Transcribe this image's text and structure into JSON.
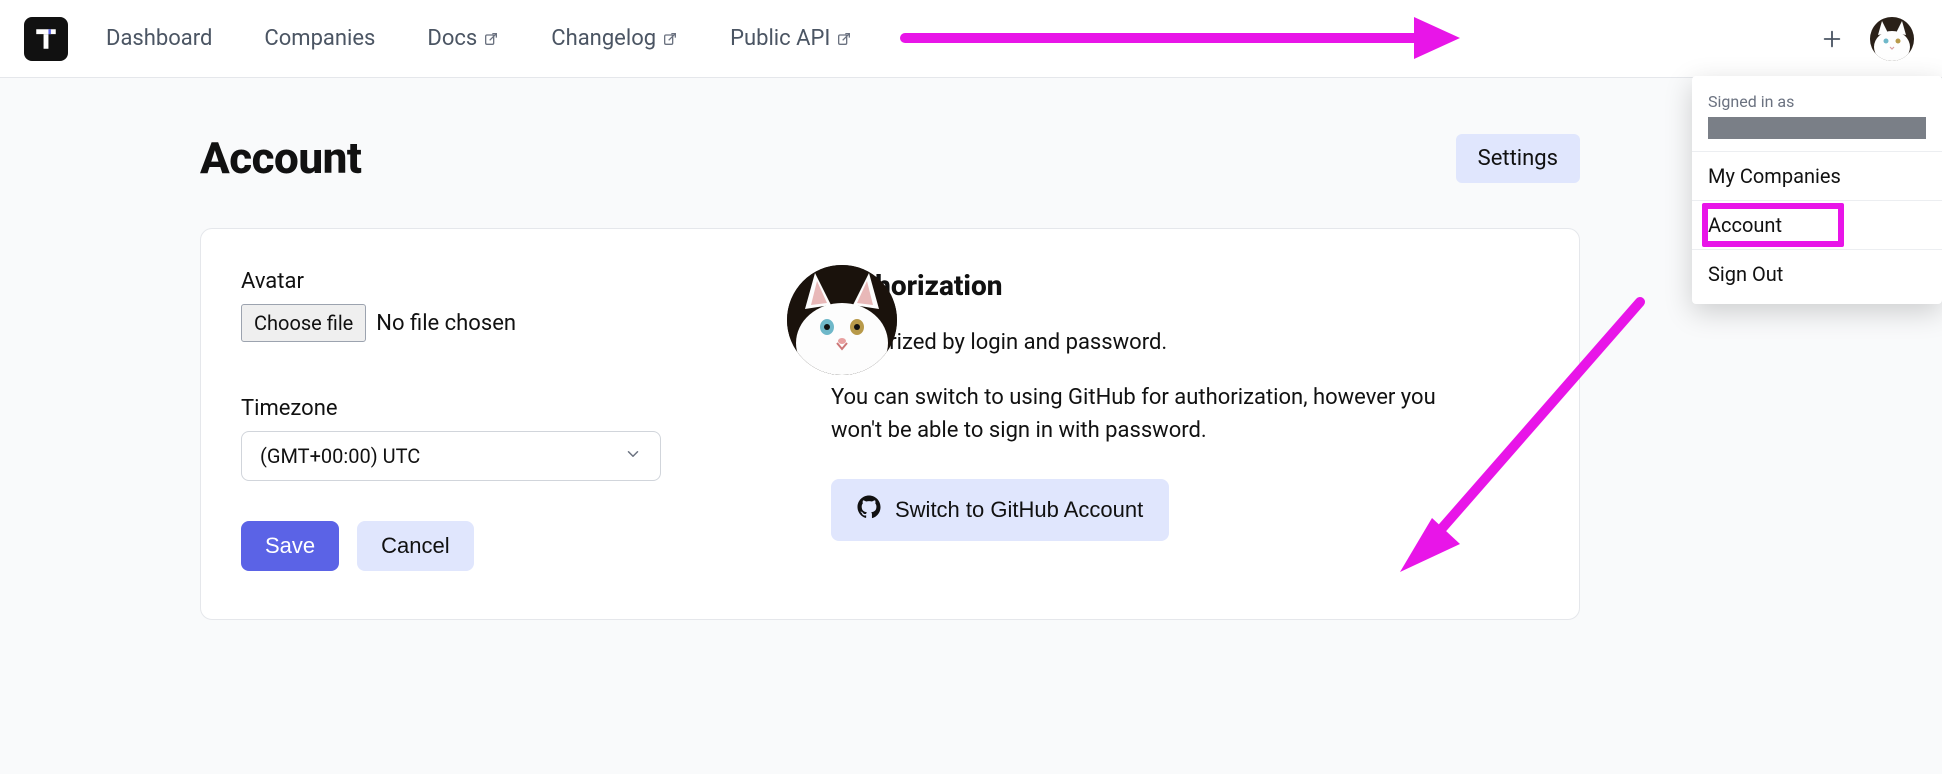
{
  "nav": {
    "items": [
      {
        "label": "Dashboard",
        "external": false
      },
      {
        "label": "Companies",
        "external": false
      },
      {
        "label": "Docs",
        "external": true
      },
      {
        "label": "Changelog",
        "external": true
      },
      {
        "label": "Public API",
        "external": true
      }
    ]
  },
  "page": {
    "title": "Account",
    "tab_label": "Settings"
  },
  "account": {
    "avatar_label": "Avatar",
    "choose_file_label": "Choose file",
    "file_status": "No file chosen",
    "timezone_label": "Timezone",
    "timezone_value": "(GMT+00:00) UTC",
    "save_label": "Save",
    "cancel_label": "Cancel"
  },
  "auth": {
    "title": "Authorization",
    "line1": "Authorized by login and password.",
    "line2": "You can switch to using GitHub for authorization, however you won't be able to sign in with password.",
    "github_button": "Switch to GitHub Account"
  },
  "dropdown": {
    "signed_in_label": "Signed in as",
    "items": [
      "My Companies",
      "Account",
      "Sign Out"
    ]
  }
}
